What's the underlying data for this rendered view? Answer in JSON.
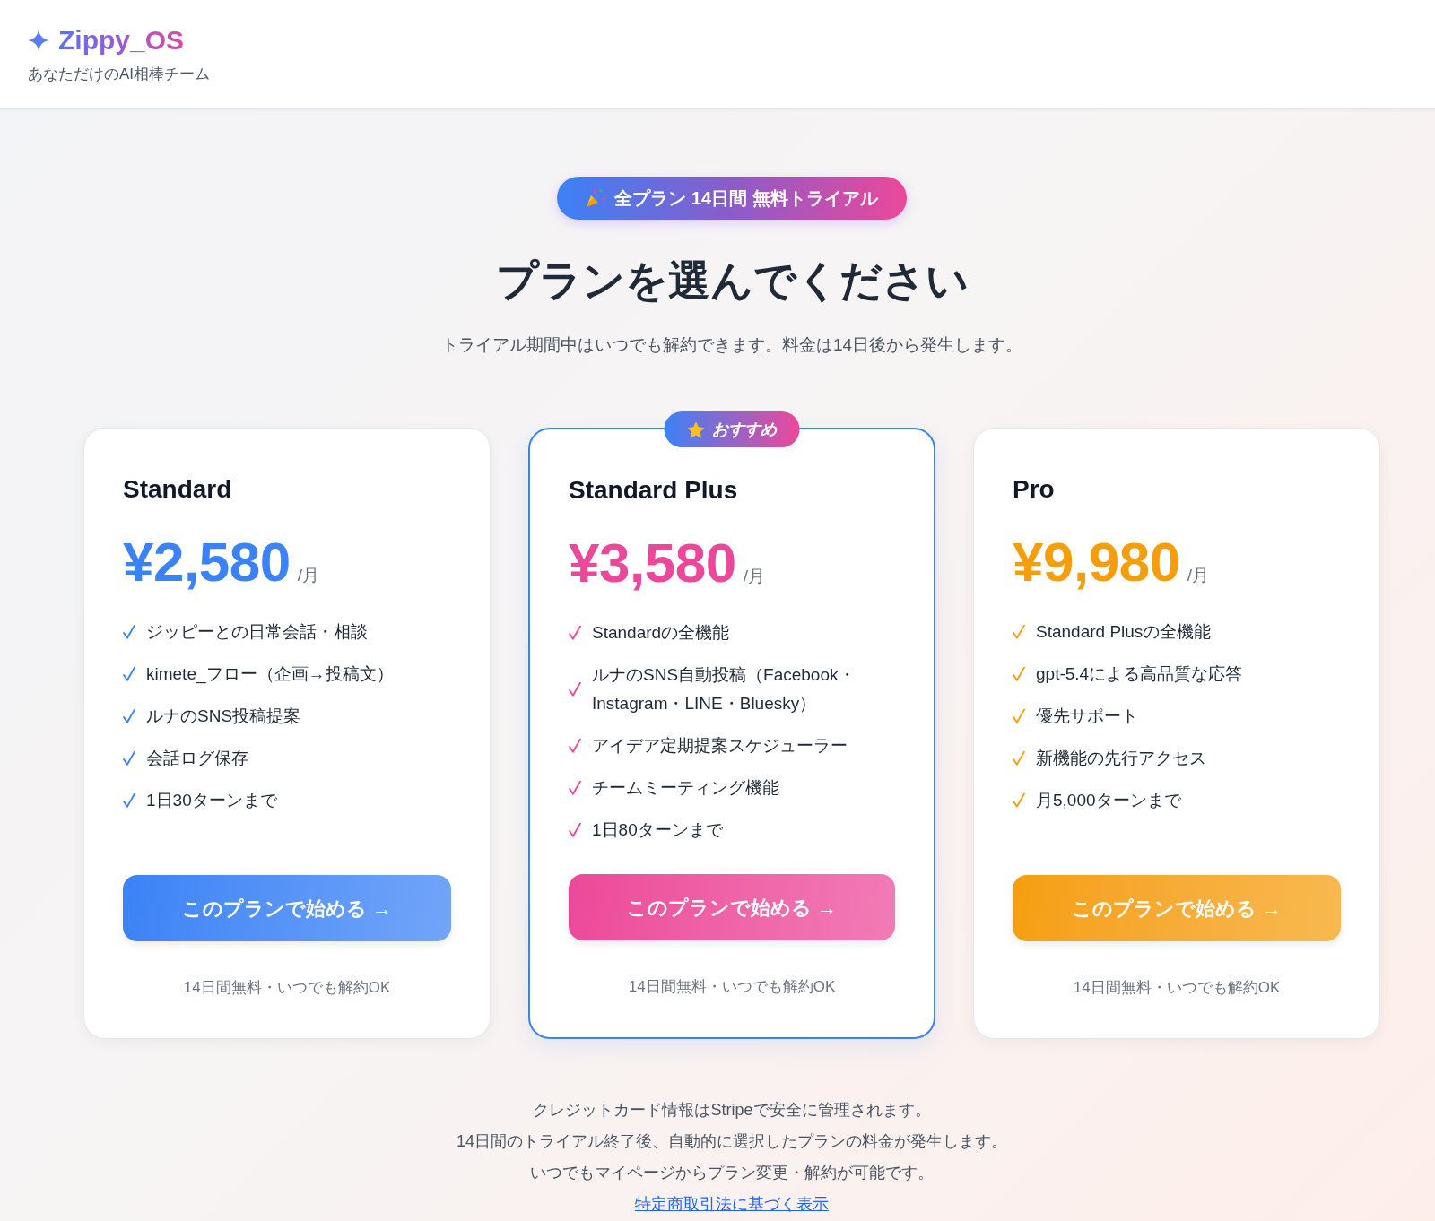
{
  "header": {
    "logo": "Zippy_OS",
    "tagline": "あなただけのAI相棒チーム"
  },
  "hero": {
    "badge": "全プラン 14日間 無料トライアル",
    "title": "プランを選んでください",
    "subtitle": "トライアル期間中はいつでも解約できます。料金は14日後から発生します。"
  },
  "plans": [
    {
      "name": "Standard",
      "price": "¥2,580",
      "period": "/月",
      "color": "#3b82f6",
      "recommended": false,
      "features": [
        "ジッピーとの日常会話・相談",
        "kimete_フロー（企画→投稿文）",
        "ルナのSNS投稿提案",
        "会話ログ保存",
        "1日30ターンまで"
      ],
      "cta": "このプランで始める →",
      "note": "14日間無料・いつでも解約OK"
    },
    {
      "name": "Standard Plus",
      "badge": "おすすめ",
      "price": "¥3,580",
      "period": "/月",
      "color": "#ec4899",
      "recommended": true,
      "features": [
        "Standardの全機能",
        "ルナのSNS自動投稿（Facebook・Instagram・LINE・Bluesky）",
        "アイデア定期提案スケジューラー",
        "チームミーティング機能",
        "1日80ターンまで"
      ],
      "cta": "このプランで始める →",
      "note": "14日間無料・いつでも解約OK"
    },
    {
      "name": "Pro",
      "price": "¥9,980",
      "period": "/月",
      "color": "#f59e0b",
      "recommended": false,
      "features": [
        "Standard Plusの全機能",
        "gpt-5.4による高品質な応答",
        "優先サポート",
        "新機能の先行アクセス",
        "月5,000ターンまで"
      ],
      "cta": "このプランで始める →",
      "note": "14日間無料・いつでも解約OK"
    }
  ],
  "footer": {
    "lines": [
      "クレジットカード情報はStripeで安全に管理されます。",
      "14日間のトライアル終了後、自動的に選択したプランの料金が発生します。",
      "いつでもマイページからプラン変更・解約が可能です。"
    ],
    "link": "特定商取引法に基づく表示"
  }
}
